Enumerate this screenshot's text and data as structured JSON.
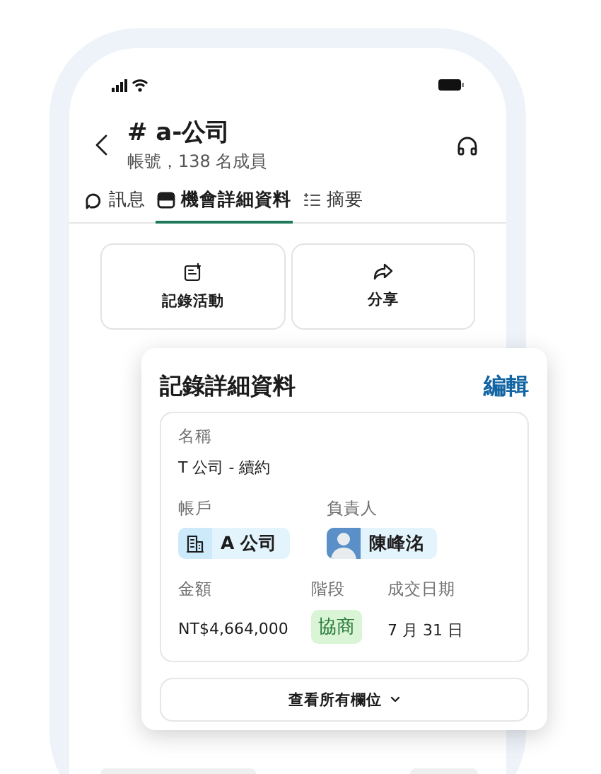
{
  "header": {
    "title": "# a-公司",
    "subtitle": "帳號，138 名成員"
  },
  "tabs": [
    {
      "label": "訊息",
      "kind": "message",
      "selected": false
    },
    {
      "label": "機會詳細資料",
      "kind": "card",
      "selected": true
    },
    {
      "label": "摘要",
      "kind": "list",
      "selected": false
    }
  ],
  "actions": [
    {
      "label": "記錄活動",
      "kind": "log"
    },
    {
      "label": "分享",
      "kind": "share"
    }
  ],
  "record": {
    "title": "記錄詳細資料",
    "edit": "編輯",
    "name_label": "名稱",
    "name": "T 公司 - 續約",
    "account_label": "帳戶",
    "account": "A 公司",
    "owner_label": "負責人",
    "owner": "陳峰洺",
    "amount_label": "金額",
    "amount": "NT$4,664,000",
    "stage_label": "階段",
    "stage": "協商",
    "date_label": "成交日期",
    "date": "7 月 31 日",
    "more": "查看所有欄位"
  }
}
